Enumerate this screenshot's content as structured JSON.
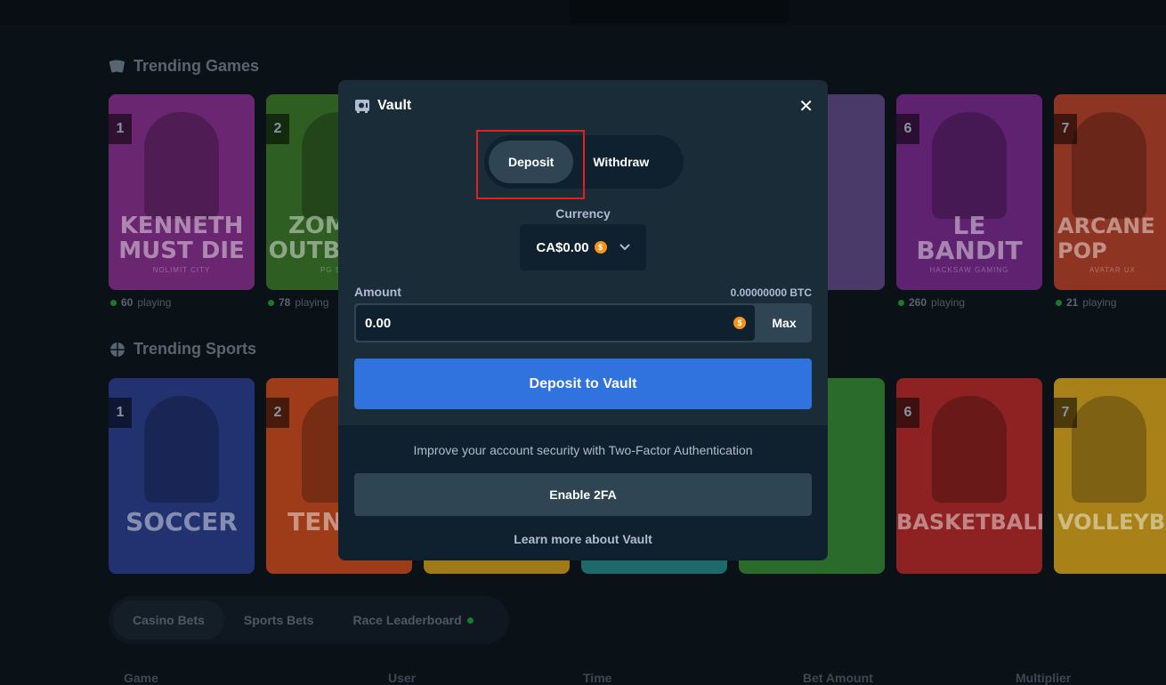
{
  "background": {
    "trending_games_title": "Trending Games",
    "trending_sports_title": "Trending Sports",
    "games": [
      {
        "rank": "1",
        "title": "KENNETH MUST DIE",
        "provider": "NOLIMIT CITY",
        "playing_count": "60",
        "playing_label": "playing",
        "color": "#8a2f8e"
      },
      {
        "rank": "2",
        "title": "ZOMBIE OUTBREAK",
        "provider": "PG SOFT",
        "playing_count": "78",
        "playing_label": "playing",
        "color": "#3a7a2a"
      },
      {
        "rank": "6",
        "title": "LE BANDIT",
        "provider": "HACKSAW GAMING",
        "playing_count": "260",
        "playing_label": "playing",
        "color": "#7a2a86"
      },
      {
        "rank": "7",
        "title": "ARCANE POP",
        "provider": "AVATAR UX",
        "playing_count": "21",
        "playing_label": "playing",
        "color": "#c2452a"
      }
    ],
    "sports": [
      {
        "rank": "1",
        "title": "SOCCER",
        "color": "#2a3f86"
      },
      {
        "rank": "2",
        "title": "TENNIS",
        "color": "#c24a20"
      },
      {
        "rank": "6",
        "title": "BASKETBALL",
        "color": "#b02a2a"
      },
      {
        "rank": "7",
        "title": "VOLLEYBALL",
        "color": "#d6a020"
      }
    ],
    "bet_tabs": [
      "Casino Bets",
      "Sports Bets",
      "Race Leaderboard"
    ],
    "columns": [
      "Game",
      "User",
      "Time",
      "Bet Amount",
      "Multiplier"
    ]
  },
  "vault": {
    "title": "Vault",
    "close_label": "✕",
    "tabs": {
      "deposit": "Deposit",
      "withdraw": "Withdraw"
    },
    "currency_label": "Currency",
    "currency_value": "CA$0.00",
    "coin_symbol": "$",
    "amount_label": "Amount",
    "amount_btc": "0.00000000 BTC",
    "amount_value": "0.00",
    "max_label": "Max",
    "submit_label": "Deposit to Vault",
    "twofa_text": "Improve your account security with Two-Factor Authentication",
    "twofa_button": "Enable 2FA",
    "learn_more": "Learn more about Vault"
  },
  "colors": {
    "modal_bg": "#1a2c38",
    "primary": "#3073de",
    "highlight": "#e81d1d"
  }
}
